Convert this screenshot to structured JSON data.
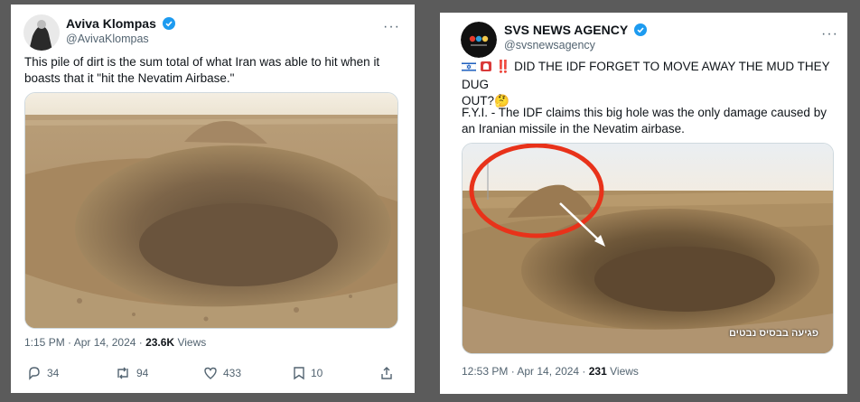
{
  "tweet1": {
    "name": "Aviva Klompas",
    "handle": "@AvivaKlompas",
    "more": "···",
    "text": "This pile of dirt is the sum total of what Iran was able to hit when it boasts that it \"hit the Nevatim Airbase.\"",
    "time": "1:15 PM · Apr 14, 2024 · ",
    "views_count": "23.6K",
    "views_label": " Views",
    "replies": "34",
    "reposts": "94",
    "likes": "433",
    "bookmarks": "10"
  },
  "tweet2": {
    "name": "SVS NEWS AGENCY",
    "handle": "@svsnewsagency",
    "more": "···",
    "line1": "‼️ DID THE IDF FORGET TO MOVE AWAY THE MUD THEY DUG",
    "line2": "OUT?🤔",
    "paragraph2": "F.Y.I. - The IDF claims this big hole was the only damage caused by an Iranian missile in the Nevatim airbase.",
    "video_caption": "פגיעה בבסיס נבטים",
    "time": "12:53 PM · Apr 14, 2024 · ",
    "views_count": "231",
    "views_label": " Views"
  },
  "colors": {
    "verified": "#1d9bf0",
    "annotation": "#e8321a",
    "text_secondary": "#536471"
  }
}
